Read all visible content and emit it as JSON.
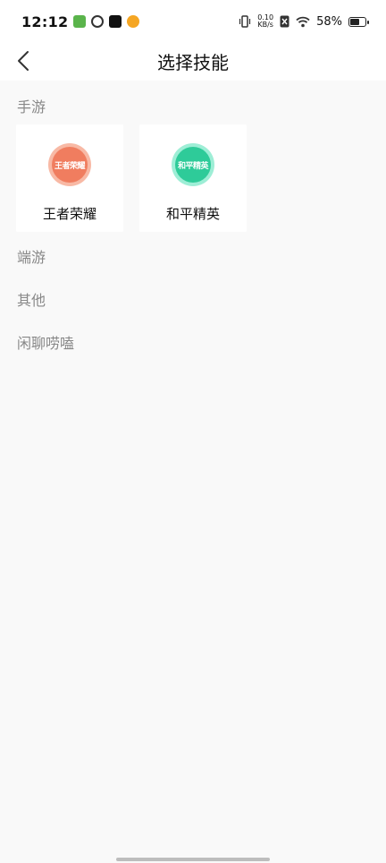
{
  "status_bar": {
    "time": "12:12",
    "net_speed_value": "0.10",
    "net_speed_unit": "KB/s",
    "battery": "58%",
    "battery_level": 0.58
  },
  "nav": {
    "title": "选择技能"
  },
  "sections": {
    "mobile_games": "手游",
    "pc_games": "端游",
    "other": "其他",
    "chat": "闲聊唠嗑"
  },
  "skills": [
    {
      "name": "王者荣耀",
      "badge": "王者荣耀",
      "icon": "honor-of-kings-icon",
      "color": "#f28a6e"
    },
    {
      "name": "和平精英",
      "badge": "和平精英",
      "icon": "peace-elite-icon",
      "color": "#38d3a6"
    }
  ],
  "colors": {
    "background": "#f9f9f9",
    "section_text": "#888888"
  }
}
